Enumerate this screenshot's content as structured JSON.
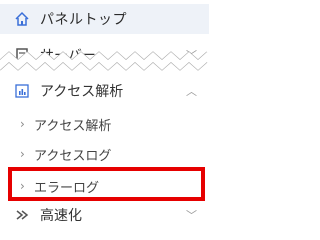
{
  "sidebar": {
    "panel_top": {
      "label": "パネルトップ",
      "icon": "home-icon"
    },
    "server": {
      "label": "サーバー",
      "icon": "server-icon",
      "caret": "﹀"
    },
    "access_analysis": {
      "label": "アクセス解析",
      "icon": "bar-chart-icon",
      "caret": "︿",
      "children": [
        {
          "label": "アクセス解析",
          "chevron": "›"
        },
        {
          "label": "アクセスログ",
          "chevron": "›"
        },
        {
          "label": "エラーログ",
          "chevron": "›"
        }
      ]
    },
    "speedup": {
      "label": "高速化",
      "icon": "speed-icon",
      "caret": "﹀"
    }
  },
  "colors": {
    "active_bg": "#eef2f8",
    "icon_blue": "#3a6fd8",
    "highlight_red": "#e60000"
  }
}
